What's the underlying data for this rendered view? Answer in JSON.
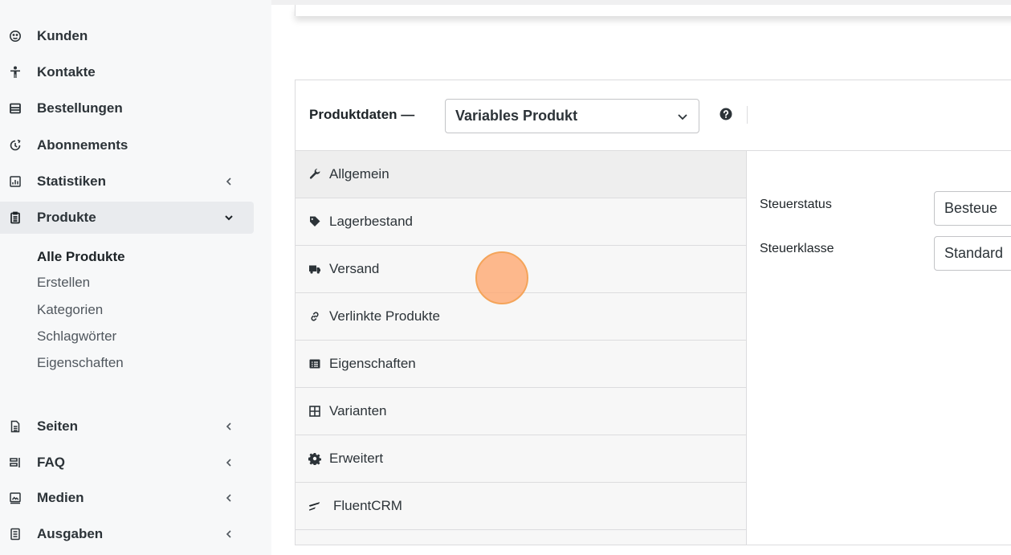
{
  "sidebar": {
    "items": [
      {
        "label": "Kunden",
        "icon": "customers-icon"
      },
      {
        "label": "Kontakte",
        "icon": "person-icon"
      },
      {
        "label": "Bestellungen",
        "icon": "orders-icon"
      },
      {
        "label": "Abonnements",
        "icon": "subscriptions-icon"
      },
      {
        "label": "Statistiken",
        "icon": "chart-icon",
        "caret": "left"
      },
      {
        "label": "Produkte",
        "icon": "product-icon",
        "caret": "down",
        "active": true
      },
      {
        "label": "Seiten",
        "icon": "page-icon",
        "caret": "left"
      },
      {
        "label": "FAQ",
        "icon": "faq-icon",
        "caret": "left"
      },
      {
        "label": "Medien",
        "icon": "media-icon",
        "caret": "left"
      },
      {
        "label": "Ausgaben",
        "icon": "expenses-icon",
        "caret": "left"
      }
    ],
    "submenu": [
      {
        "label": "Alle Produkte",
        "current": true
      },
      {
        "label": "Erstellen"
      },
      {
        "label": "Kategorien"
      },
      {
        "label": "Schlagwörter"
      },
      {
        "label": "Eigenschaften"
      }
    ]
  },
  "panel": {
    "title": "Produktdaten —",
    "product_type": "Variables Produkt",
    "help_icon": "question-circle-icon",
    "tabs": [
      {
        "label": "Allgemein",
        "icon": "wrench-icon",
        "active": true
      },
      {
        "label": "Lagerbestand",
        "icon": "tag-icon"
      },
      {
        "label": "Versand",
        "icon": "truck-icon"
      },
      {
        "label": "Verlinkte Produkte",
        "icon": "link-icon"
      },
      {
        "label": "Eigenschaften",
        "icon": "list-icon"
      },
      {
        "label": "Varianten",
        "icon": "grid-icon"
      },
      {
        "label": "Erweitert",
        "icon": "gear-icon"
      },
      {
        "label": "FluentCRM",
        "icon": "fluentcrm-icon"
      }
    ],
    "fields": [
      {
        "label": "Steuerstatus",
        "value": "Besteue"
      },
      {
        "label": "Steuerklasse",
        "value": "Standard"
      }
    ]
  },
  "colors": {
    "sidebar_bg": "#f7f8f9",
    "active_item_bg": "#e9ebee",
    "tabs_bg": "#f7f7f7",
    "border": "#dcdcde",
    "click_marker": "#ffa66e"
  }
}
